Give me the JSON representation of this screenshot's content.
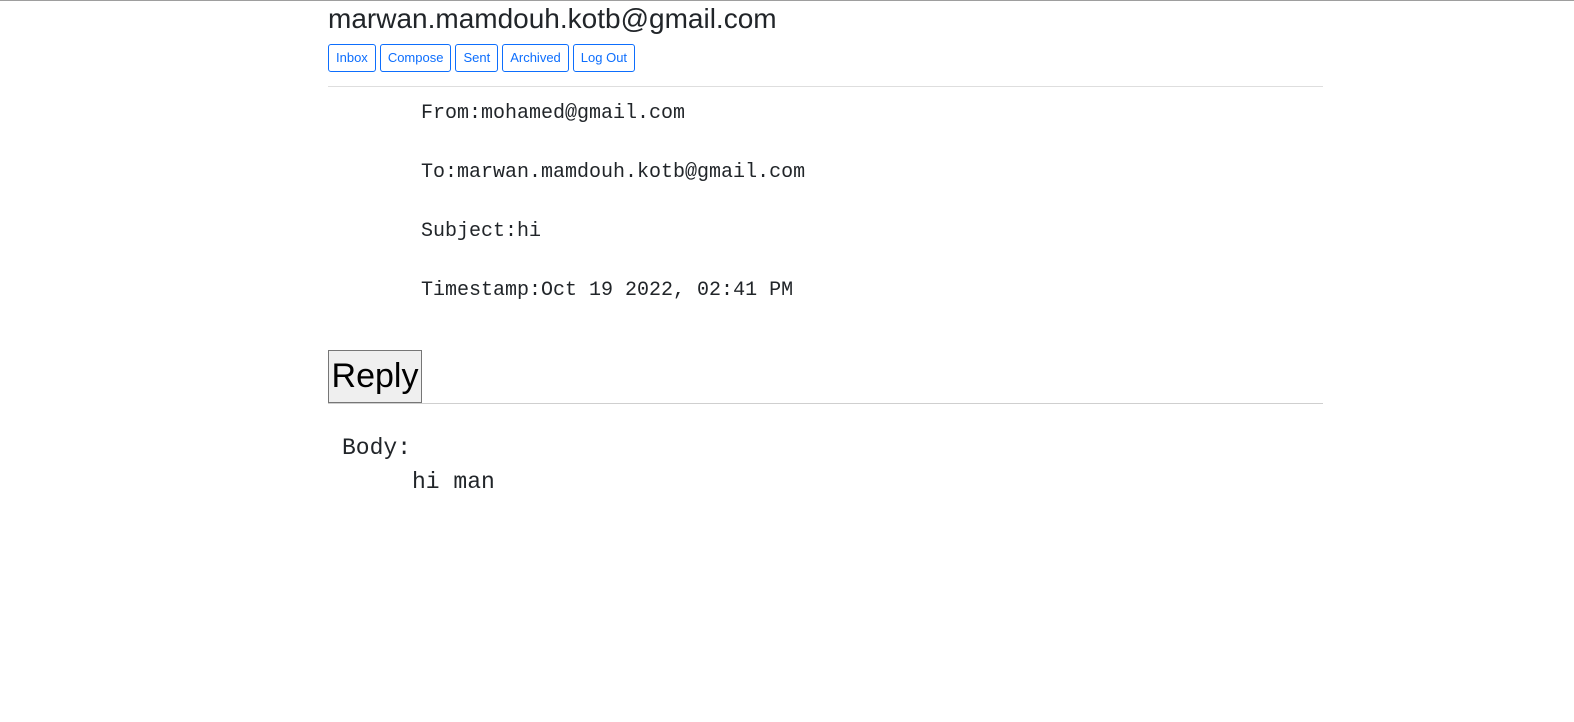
{
  "header": {
    "user_email": "marwan.mamdouh.kotb@gmail.com"
  },
  "nav": {
    "inbox": "Inbox",
    "compose": "Compose",
    "sent": "Sent",
    "archived": "Archived",
    "logout": "Log Out"
  },
  "email": {
    "from_label": "From:",
    "from": "mohamed@gmail.com",
    "to_label": "To:",
    "to": "marwan.mamdouh.kotb@gmail.com",
    "subject_label": "Subject:",
    "subject": "hi",
    "timestamp_label": "Timestamp:",
    "timestamp": "Oct 19 2022, 02:41 PM",
    "reply_label": "Reply",
    "body_label": "Body:",
    "body": "hi man"
  },
  "colors": {
    "accent": "#0d6efd",
    "text": "#212529",
    "reply_bg": "#efefef"
  }
}
